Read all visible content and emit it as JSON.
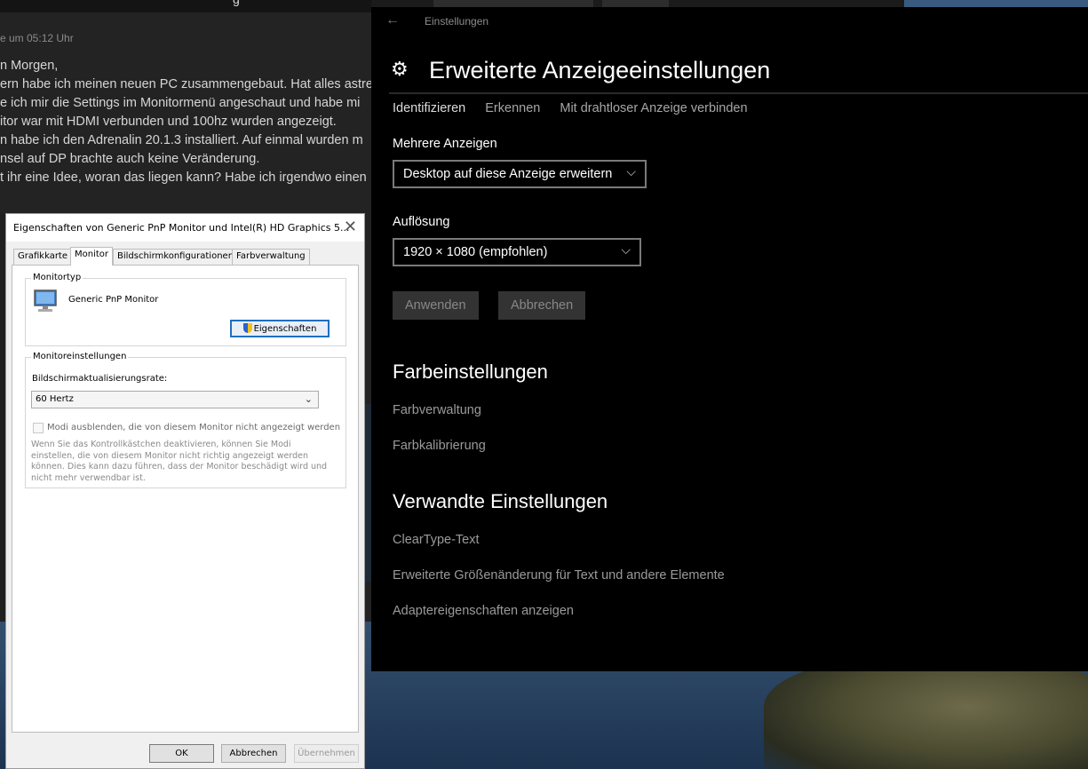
{
  "forum": {
    "tab_title": "g",
    "post_time": "e um 05:12 Uhr",
    "lines": [
      "n Morgen,",
      "ern habe ich meinen neuen PC zusammengebaut. Hat alles astre",
      "e ich mir die Settings im Monitormenü angeschaut und habe mi",
      "itor war mit HDMI verbunden und 100hz wurden angezeigt.",
      "n habe ich den Adrenalin 20.1.3 installiert. Auf einmal wurden m",
      "nsel auf DP brachte auch keine Veränderung.",
      "t ihr eine Idee, woran das liegen kann? Habe ich irgendwo einen"
    ]
  },
  "settings": {
    "app_title": "Einstellungen",
    "page_title": "Erweiterte Anzeigeeinstellungen",
    "top_links": [
      "Identifizieren",
      "Erkennen",
      "Mit drahtloser Anzeige verbinden"
    ],
    "multiple_displays_label": "Mehrere Anzeigen",
    "multiple_displays_value": "Desktop auf diese Anzeige erweitern",
    "resolution_label": "Auflösung",
    "resolution_value": "1920 × 1080 (empfohlen)",
    "apply_label": "Anwenden",
    "cancel_label": "Abbrechen",
    "color_section_title": "Farbeinstellungen",
    "color_links": [
      "Farbverwaltung",
      "Farbkalibrierung"
    ],
    "related_section_title": "Verwandte Einstellungen",
    "related_links": [
      "ClearType-Text",
      "Erweiterte Größenänderung für Text und andere Elemente",
      "Adaptereigenschaften anzeigen"
    ]
  },
  "dialog": {
    "title": "Eigenschaften von Generic PnP Monitor und Intel(R) HD Graphics 5...",
    "tabs": [
      "Grafikkarte",
      "Monitor",
      "Bildschirmkonfigurationen",
      "Farbverwaltung"
    ],
    "active_tab": "Monitor",
    "monitor_type_group": "Monitortyp",
    "monitor_name": "Generic PnP Monitor",
    "properties_button": "Eigenschaften",
    "monitor_settings_group": "Monitoreinstellungen",
    "refresh_rate_label": "Bildschirmaktualisierungsrate:",
    "refresh_rate_value": "60 Hertz",
    "hide_modes_label": "Modi ausblenden, die von diesem Monitor nicht angezeigt werden",
    "hide_modes_checked": false,
    "warning_text": "Wenn Sie das Kontrollkästchen deaktivieren, können Sie Modi einstellen, die von diesem Monitor nicht richtig angezeigt werden können. Dies kann dazu führen, dass der Monitor beschädigt wird und nicht mehr verwendbar ist.",
    "ok_label": "OK",
    "cancel_label": "Abbrechen",
    "apply_label": "Übernehmen"
  }
}
